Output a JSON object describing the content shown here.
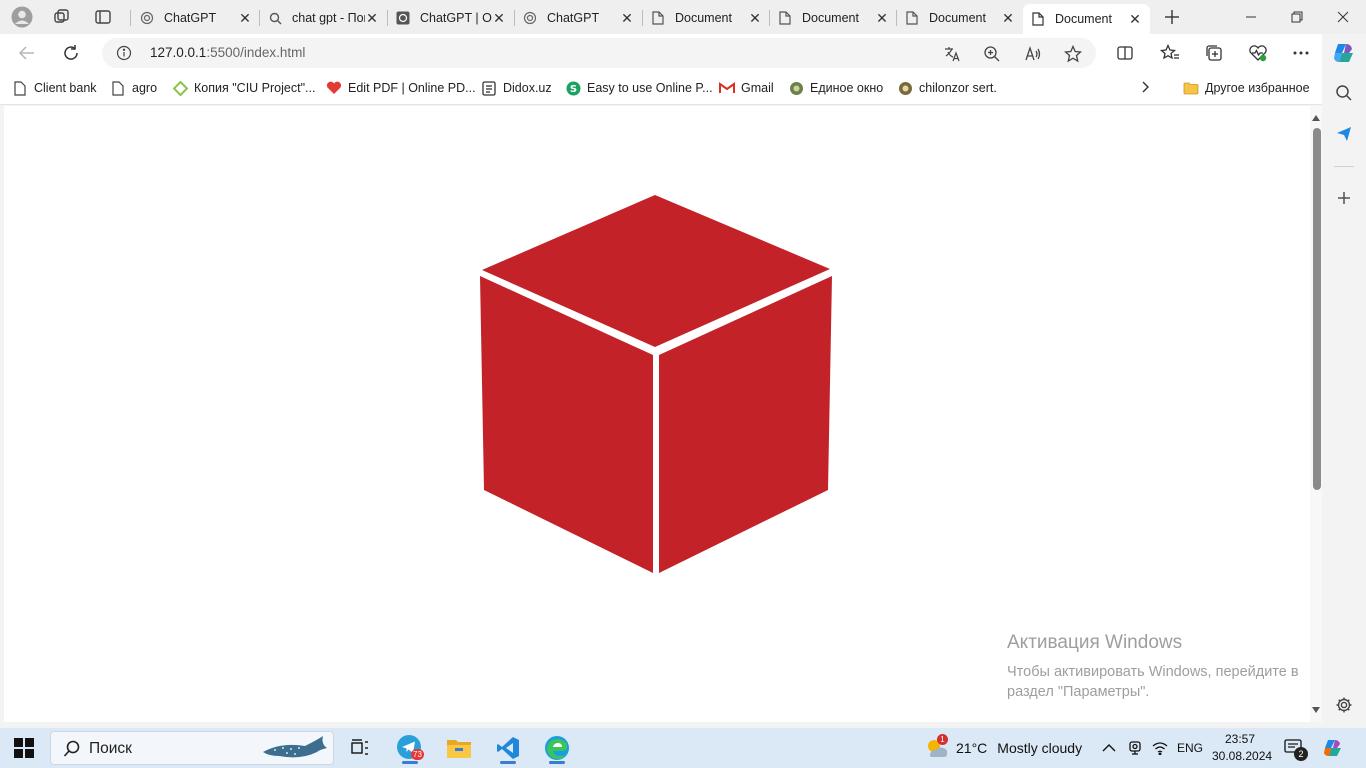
{
  "tabs": [
    {
      "title": "ChatGPT",
      "icon": "openai-icon"
    },
    {
      "title": "chat gpt - Поиск",
      "icon": "search-icon"
    },
    {
      "title": "ChatGPT | OpenAI",
      "icon": "openai-icon"
    },
    {
      "title": "ChatGPT",
      "icon": "openai-icon"
    },
    {
      "title": "Document",
      "icon": "page-icon"
    },
    {
      "title": "Document",
      "icon": "page-icon"
    },
    {
      "title": "Document",
      "icon": "page-icon"
    },
    {
      "title": "Document",
      "icon": "page-icon",
      "active": true
    }
  ],
  "address": {
    "host": "127.0.0.1",
    "rest": ":5500/index.html"
  },
  "favorites": [
    {
      "label": "Client bank",
      "icon": "page-icon"
    },
    {
      "label": "agro",
      "icon": "page-icon"
    },
    {
      "label": "Копия \"CIU Project\"...",
      "icon": "diamond-icon"
    },
    {
      "label": "Edit PDF | Online PD...",
      "icon": "heart-icon"
    },
    {
      "label": "Didox.uz",
      "icon": "doc-icon"
    },
    {
      "label": "Easy to use Online P...",
      "icon": "s-circle-icon"
    },
    {
      "label": "Gmail",
      "icon": "gmail-icon"
    },
    {
      "label": "Единое окно",
      "icon": "emblem-icon"
    },
    {
      "label": "chilonzor sert.",
      "icon": "emblem-icon"
    }
  ],
  "other_favorites": "Другое избранное",
  "watermark": {
    "title": "Активация Windows",
    "line1": "Чтобы активировать Windows, перейдите в",
    "line2": "раздел \"Параметры\"."
  },
  "cube": {
    "color": "#c42229"
  },
  "taskbar": {
    "search_placeholder": "Поиск",
    "telegram_badge": "73",
    "weather_badge": "1",
    "weather_temp": "21°C",
    "weather_desc": "Mostly cloudy",
    "language": "ENG",
    "time": "23:57",
    "date": "30.08.2024",
    "notifications": "2"
  }
}
